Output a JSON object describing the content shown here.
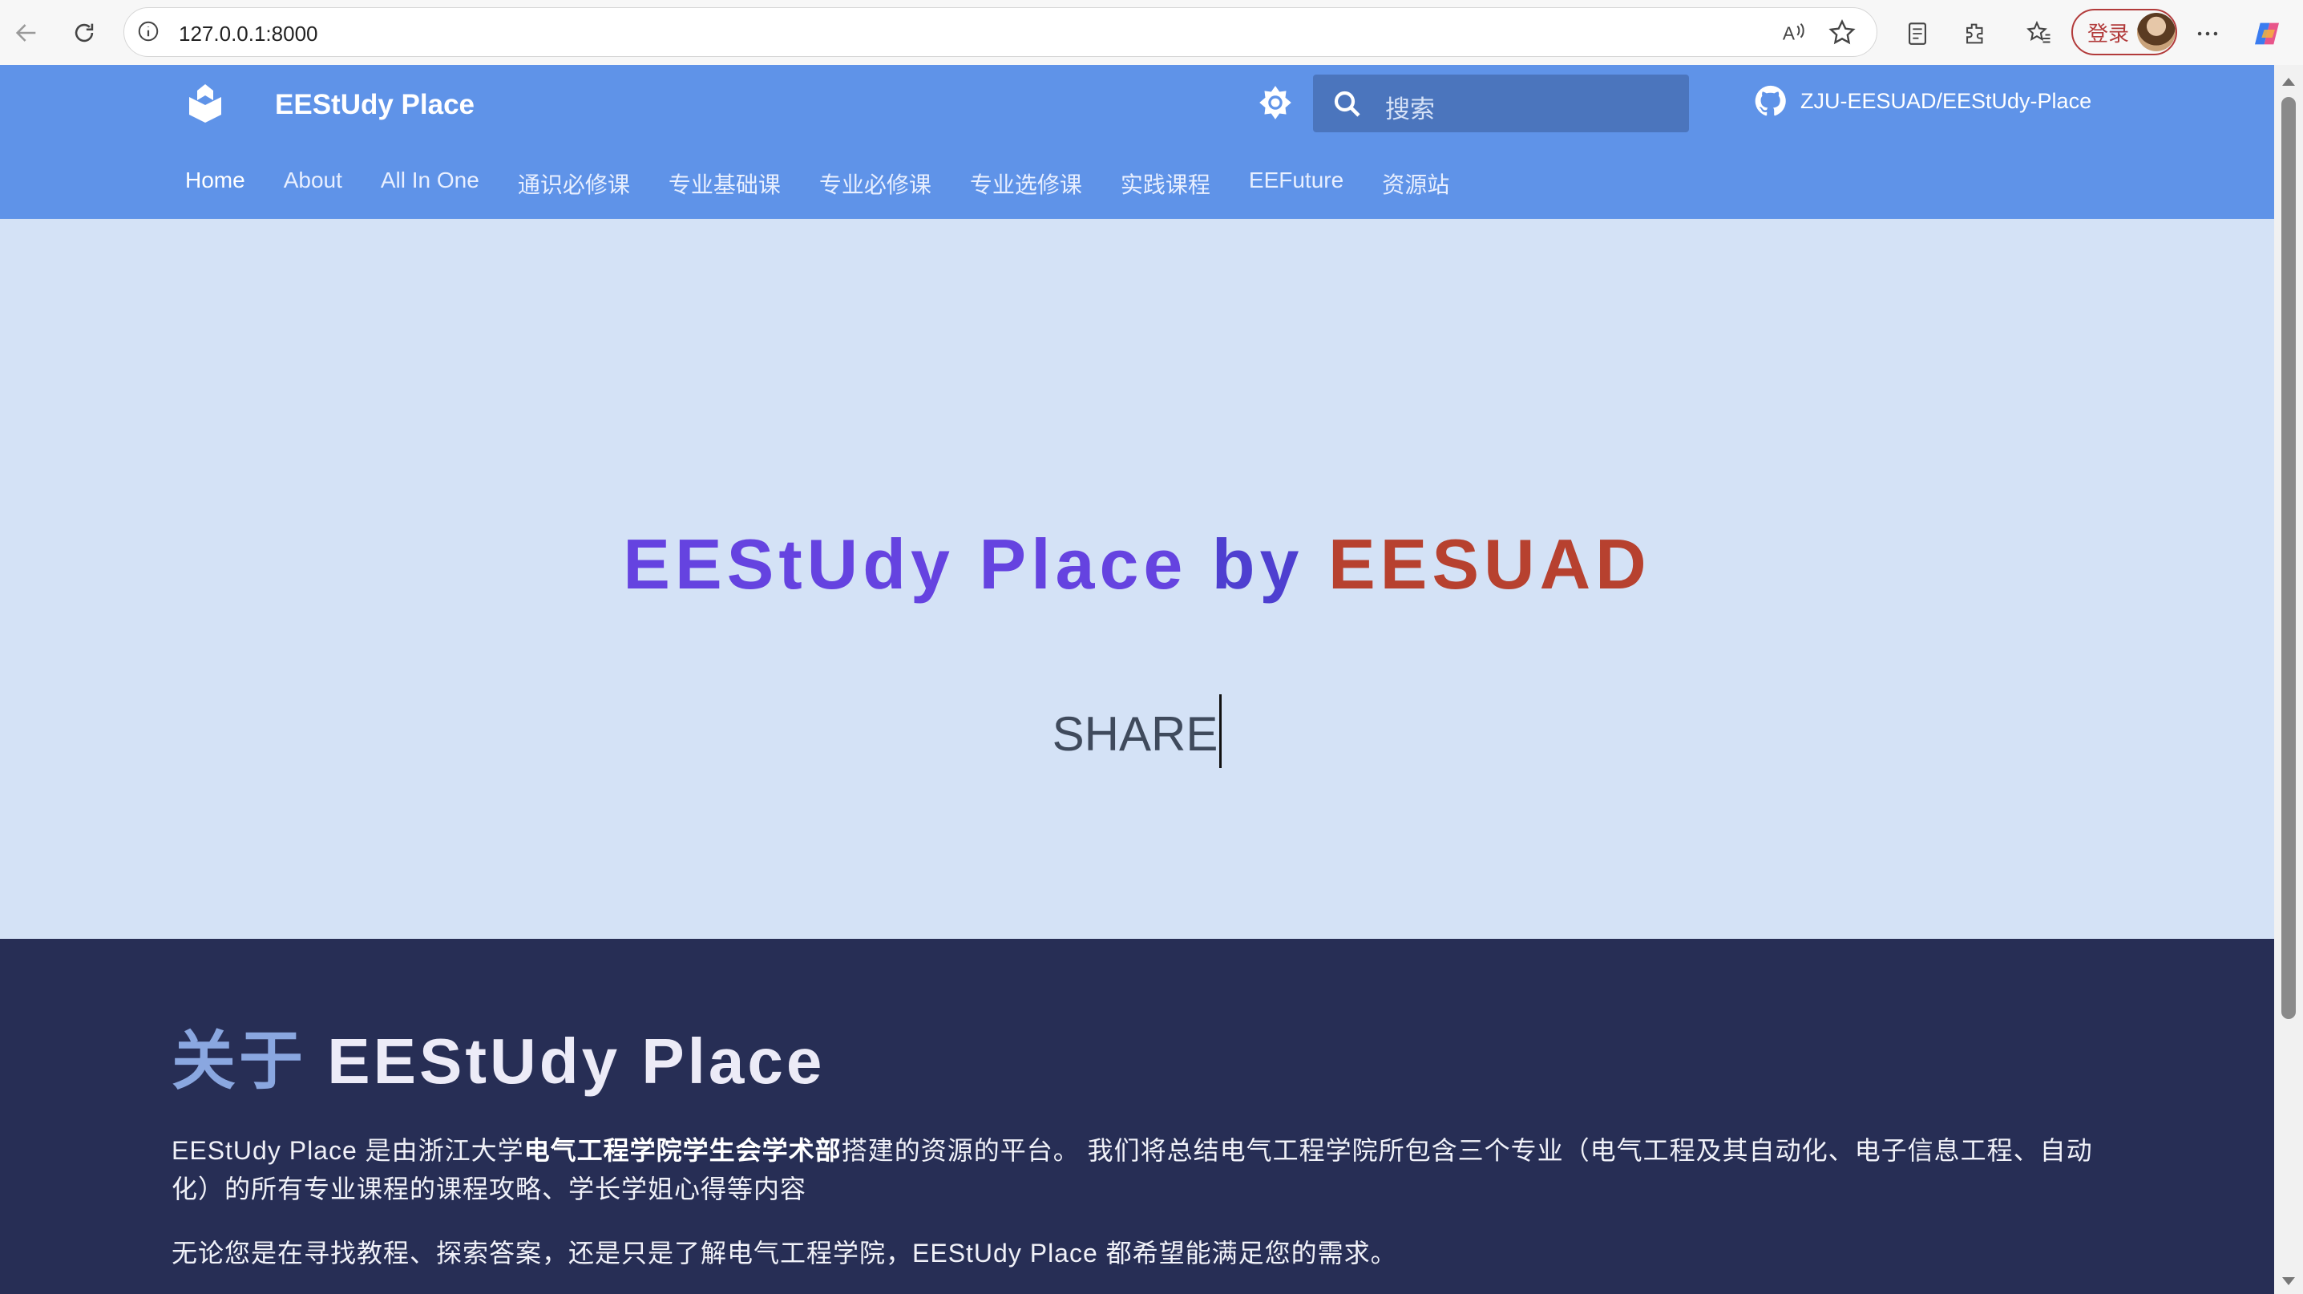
{
  "browser": {
    "url": "127.0.0.1:8000",
    "login_label": "登录"
  },
  "site": {
    "brand": "EEStUdy Place",
    "search_placeholder": "搜索",
    "repo": "ZJU-EESUAD/EEStUdy-Place",
    "tabs": [
      "Home",
      "About",
      "All In One",
      "通识必修课",
      "专业基础课",
      "专业必修课",
      "专业选修课",
      "实践课程",
      "EEFuture",
      "资源站"
    ]
  },
  "hero": {
    "title_part1": "EEStUdy Place",
    "title_part2": "by",
    "title_part3": "EESUAD",
    "typed": "SHARE"
  },
  "about": {
    "heading_prefix": "关于",
    "heading_rest": "EEStUdy Place",
    "p1_a": "EEStUdy Place 是由浙江大学",
    "p1_bold": "电气工程学院学生会学术部",
    "p1_b": "搭建的资源的平台。 我们将总结电气工程学院所包含三个专业（电气工程及其自动化、电子信息工程、自动化）的所有专业课程的课程攻略、学长学姐心得等内容",
    "p2": "无论您是在寻找教程、探索答案，还是只是了解电气工程学院，EEStUdy Place 都希望能满足您的需求。"
  },
  "colors": {
    "header": "#5f93e8",
    "hero_bg": "#d4e2f6",
    "about_bg": "#272e55",
    "title_purple": "#6543e0",
    "title_red": "#b7412f"
  }
}
